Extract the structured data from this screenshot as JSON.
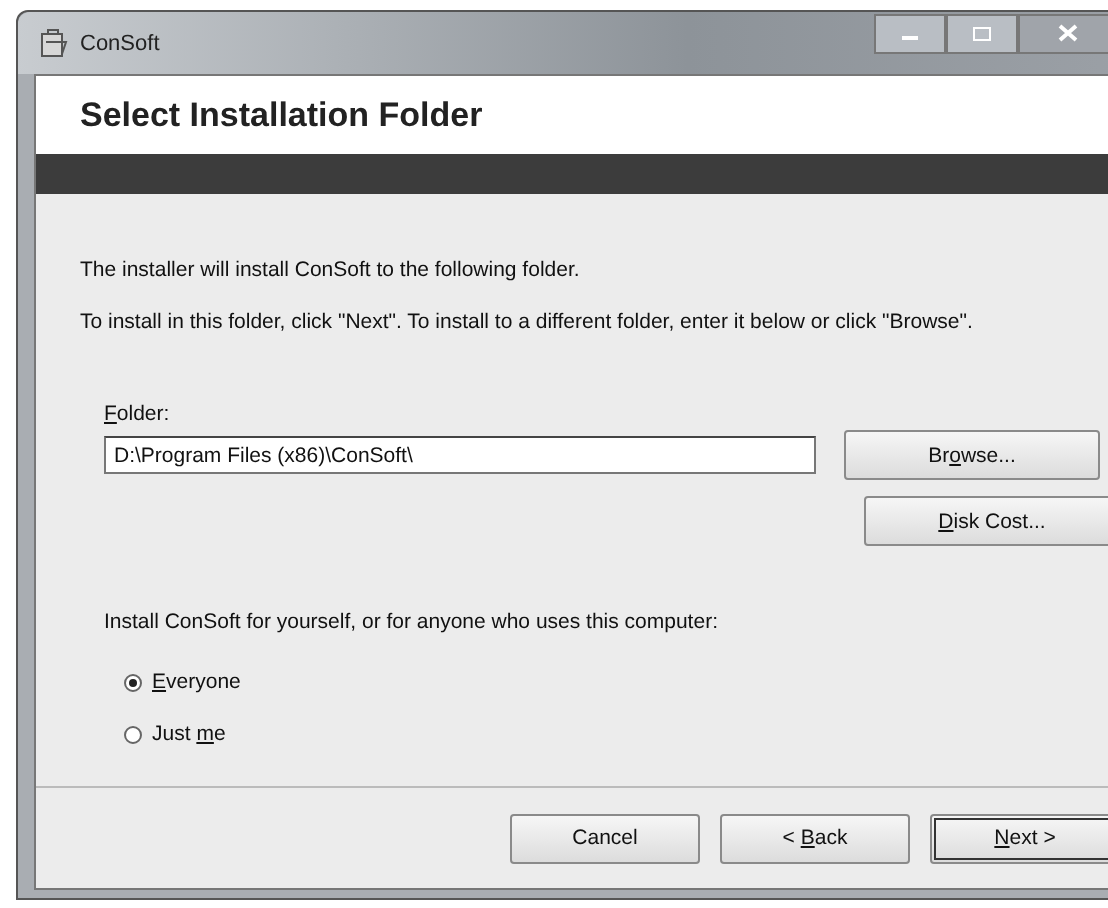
{
  "window": {
    "title": "ConSoft"
  },
  "header": {
    "title": "Select Installation Folder"
  },
  "intro": [
    "The installer will install ConSoft to the following folder.",
    "To install in this folder, click \"Next\". To install to a different folder, enter it below or click \"Browse\"."
  ],
  "folder": {
    "label": {
      "key": "F",
      "after": "older:"
    },
    "value": "D:\\Program Files (x86)\\ConSoft\\"
  },
  "side_buttons": [
    {
      "before": "Br",
      "key": "o",
      "after": "wse..."
    },
    {
      "key": "D",
      "after": "isk Cost..."
    }
  ],
  "scope": {
    "prompt": "Install ConSoft for yourself, or for anyone who uses this computer:",
    "options": [
      {
        "key": "E",
        "after": "veryone",
        "selected": true
      },
      {
        "before": "Just ",
        "key": "m",
        "after": "e",
        "selected": false
      }
    ]
  },
  "footer_buttons": [
    {
      "before": "Cancel",
      "default": false
    },
    {
      "before": "< ",
      "key": "B",
      "after": "ack",
      "default": false
    },
    {
      "key": "N",
      "after": "ext >",
      "default": true
    }
  ]
}
